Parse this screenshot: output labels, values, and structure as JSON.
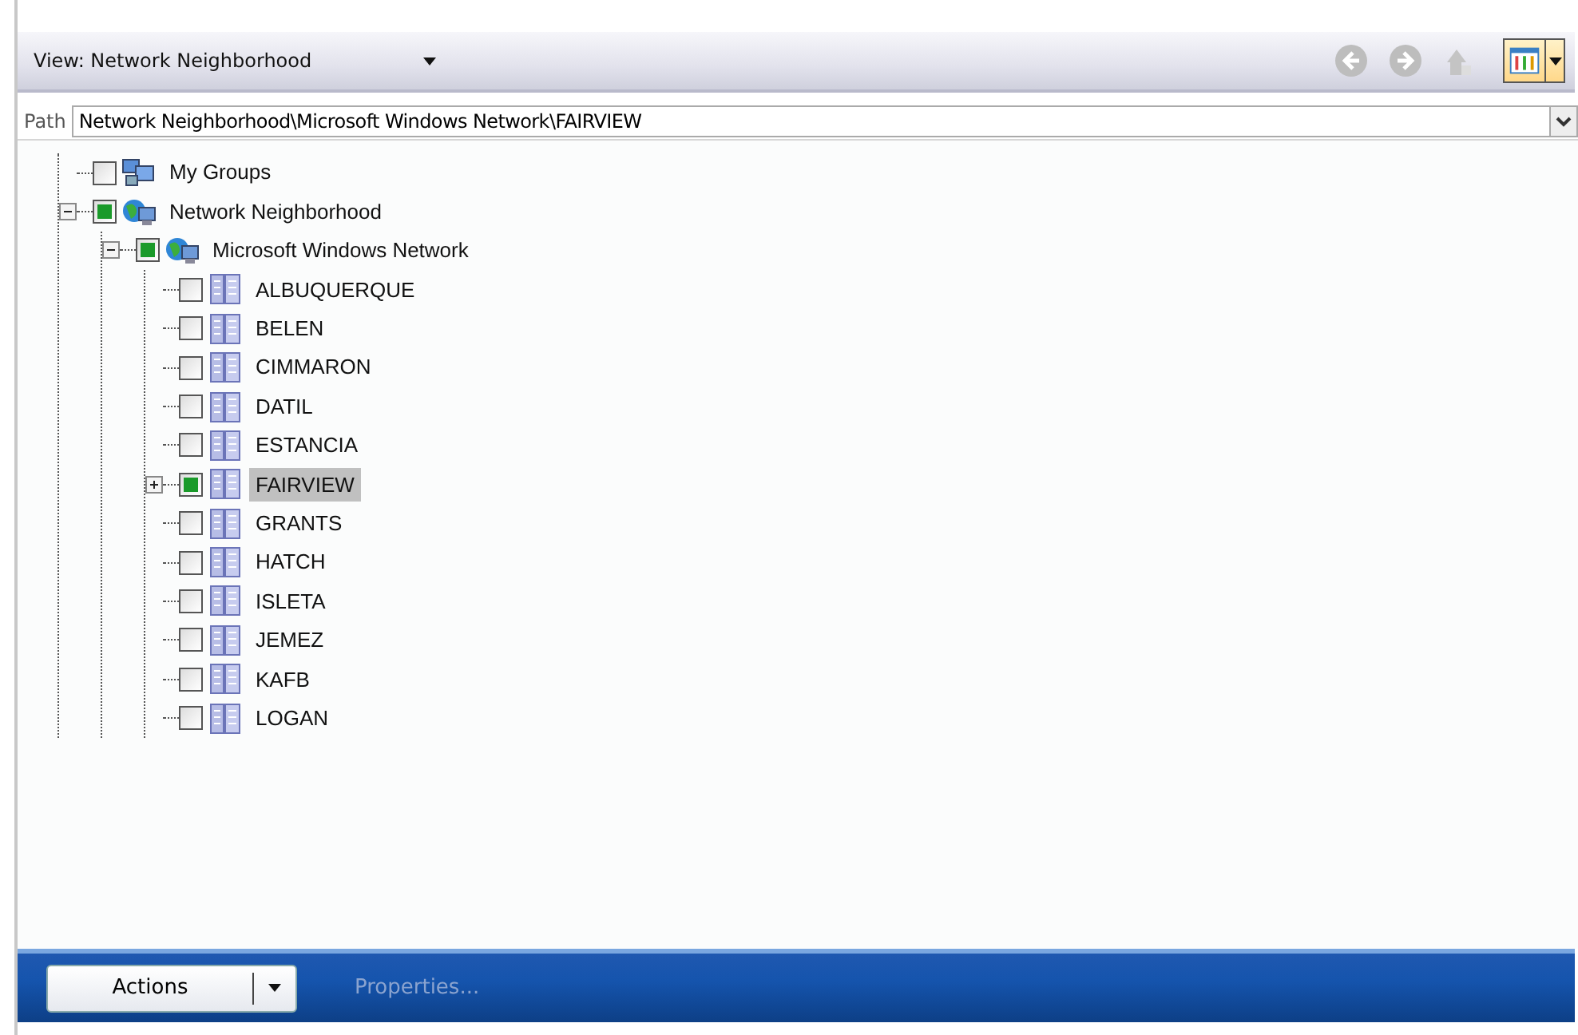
{
  "toolbar": {
    "view_label": "View: Network Neighborhood",
    "back_disabled": true,
    "forward_disabled": true,
    "up_disabled": true
  },
  "path": {
    "label": "Path",
    "value": "Network Neighborhood\\Microsoft Windows Network\\FAIRVIEW"
  },
  "tree": [
    {
      "label": "My Groups",
      "kind": "group",
      "checked": false,
      "selected": false
    },
    {
      "label": "Network Neighborhood",
      "kind": "network",
      "checked": true,
      "selected": false,
      "expanded": true,
      "children": [
        {
          "label": "Microsoft Windows Network",
          "kind": "network",
          "checked": true,
          "selected": false,
          "expanded": true,
          "children": [
            {
              "label": "ALBUQUERQUE",
              "kind": "server",
              "checked": false,
              "selected": false
            },
            {
              "label": "BELEN",
              "kind": "server",
              "checked": false,
              "selected": false
            },
            {
              "label": "CIMMARON",
              "kind": "server",
              "checked": false,
              "selected": false
            },
            {
              "label": "DATIL",
              "kind": "server",
              "checked": false,
              "selected": false
            },
            {
              "label": "ESTANCIA",
              "kind": "server",
              "checked": false,
              "selected": false
            },
            {
              "label": "FAIRVIEW",
              "kind": "server",
              "checked": true,
              "selected": true,
              "expanded": false
            },
            {
              "label": "GRANTS",
              "kind": "server",
              "checked": false,
              "selected": false
            },
            {
              "label": "HATCH",
              "kind": "server",
              "checked": false,
              "selected": false
            },
            {
              "label": "ISLETA",
              "kind": "server",
              "checked": false,
              "selected": false
            },
            {
              "label": "JEMEZ",
              "kind": "server",
              "checked": false,
              "selected": false
            },
            {
              "label": "KAFB",
              "kind": "server",
              "checked": false,
              "selected": false
            },
            {
              "label": "LOGAN",
              "kind": "server",
              "checked": false,
              "selected": false
            }
          ]
        }
      ]
    }
  ],
  "actions": {
    "button": "Actions",
    "link": "Properties...",
    "link_disabled": true
  }
}
